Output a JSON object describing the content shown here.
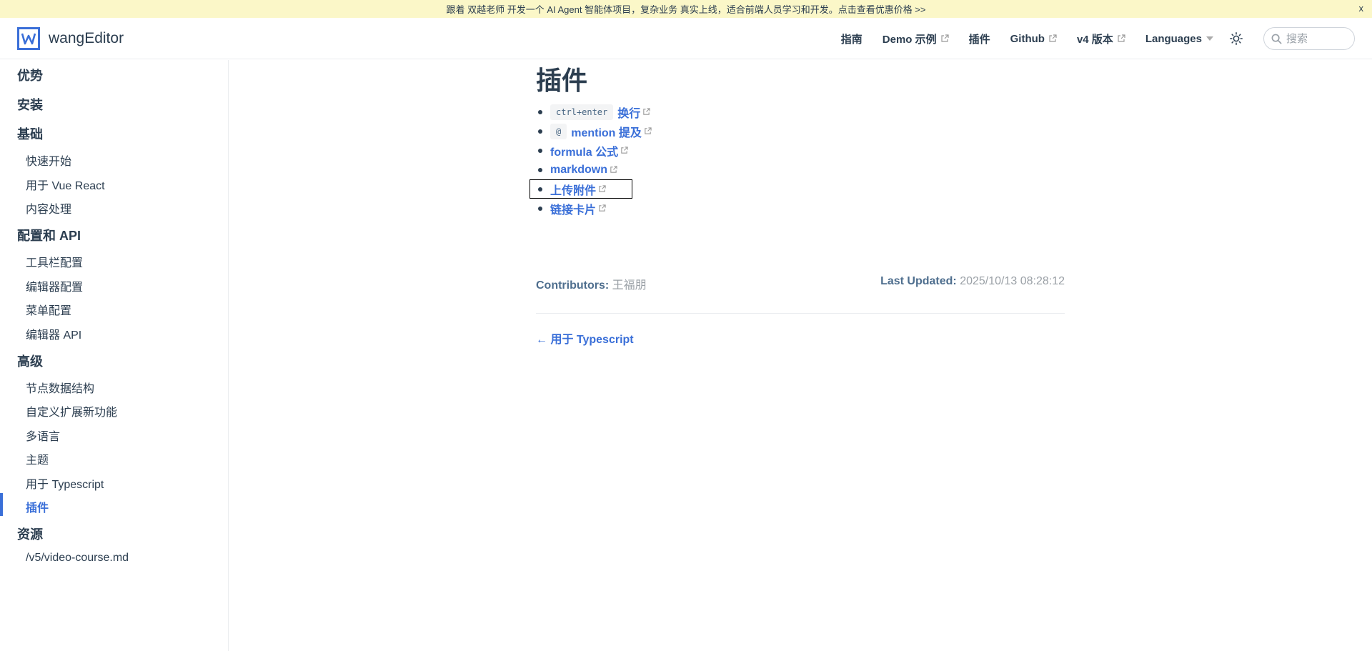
{
  "banner": {
    "text": "跟着 双越老师 开发一个 AI Agent 智能体项目，复杂业务 真实上线，适合前端人员学习和开发。点击查看优惠价格 >>",
    "close": "x"
  },
  "brand": {
    "name": "wangEditor",
    "logo_icon": "wangeditor-logo-icon"
  },
  "nav": {
    "items": [
      {
        "label": "指南",
        "external": false
      },
      {
        "label": "Demo 示例",
        "external": true
      },
      {
        "label": "插件",
        "external": false
      },
      {
        "label": "Github",
        "external": true
      },
      {
        "label": "v4 版本",
        "external": true
      }
    ],
    "languages": "Languages",
    "theme_icon": "sun-icon",
    "search_placeholder": "搜索"
  },
  "sidebar": {
    "groups": [
      {
        "title": "优势",
        "items": []
      },
      {
        "title": "安装",
        "items": []
      },
      {
        "title": "基础",
        "items": [
          "快速开始",
          "用于 Vue React",
          "内容处理"
        ]
      },
      {
        "title": "配置和 API",
        "items": [
          "工具栏配置",
          "编辑器配置",
          "菜单配置",
          "编辑器 API"
        ]
      },
      {
        "title": "高级",
        "items": [
          "节点数据结构",
          "自定义扩展新功能",
          "多语言",
          "主题",
          "用于 Typescript",
          "插件"
        ]
      },
      {
        "title": "资源",
        "items": [
          "/v5/video-course.md"
        ]
      }
    ],
    "active": "插件"
  },
  "content": {
    "title": "插件",
    "plugins": [
      {
        "code": "ctrl+enter",
        "label": "换行"
      },
      {
        "code": "@",
        "label": "mention 提及"
      },
      {
        "code": "",
        "label": "formula 公式"
      },
      {
        "code": "",
        "label": "markdown"
      },
      {
        "code": "",
        "label": "上传附件"
      },
      {
        "code": "",
        "label": "链接卡片"
      }
    ],
    "contributors_label": "Contributors:",
    "contributors_value": "王福朋",
    "last_updated_label": "Last Updated:",
    "last_updated_value": "2025/10/13 08:28:12",
    "prev_link": "← 用于 Typescript"
  },
  "colors": {
    "accent": "#3a6fd8",
    "text": "#2c3e50",
    "banner_bg": "#fbf7c8"
  }
}
